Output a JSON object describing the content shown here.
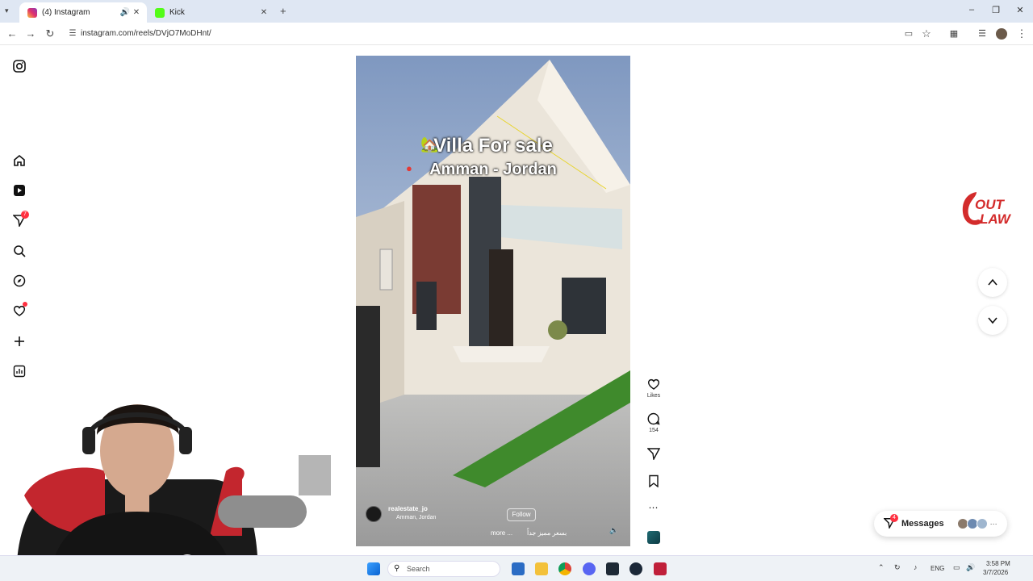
{
  "browser": {
    "tabs": [
      {
        "title": "(4) Instagram",
        "active": true
      },
      {
        "title": "Kick",
        "active": false
      }
    ],
    "url": "instagram.com/reels/DVjO7MoDHnt/"
  },
  "sidebar": {
    "notifications_badge": "7"
  },
  "reel": {
    "title_line1": "Villa For sale",
    "title_line2": "Amman - Jordan",
    "username": "realestate_jo",
    "location": "Amman, Jordan",
    "follow_label": "Follow",
    "caption": "بسعر مميز جداً",
    "caption_more": "more ..."
  },
  "actions": {
    "likes_label": "Likes",
    "comments_count": "154"
  },
  "messages": {
    "label": "Messages",
    "badge": "4"
  },
  "overlay": {
    "logo_line1": "OUT",
    "logo_line2": "LAW"
  },
  "taskbar": {
    "search_label": "Search",
    "language": "ENG",
    "time": "3:58 PM",
    "date": "3/7/2026"
  },
  "colors": {
    "accent": "#0095f6",
    "badge": "#ff3040",
    "tabbar": "#dfe7f3",
    "logo_red": "#d32b2b"
  }
}
